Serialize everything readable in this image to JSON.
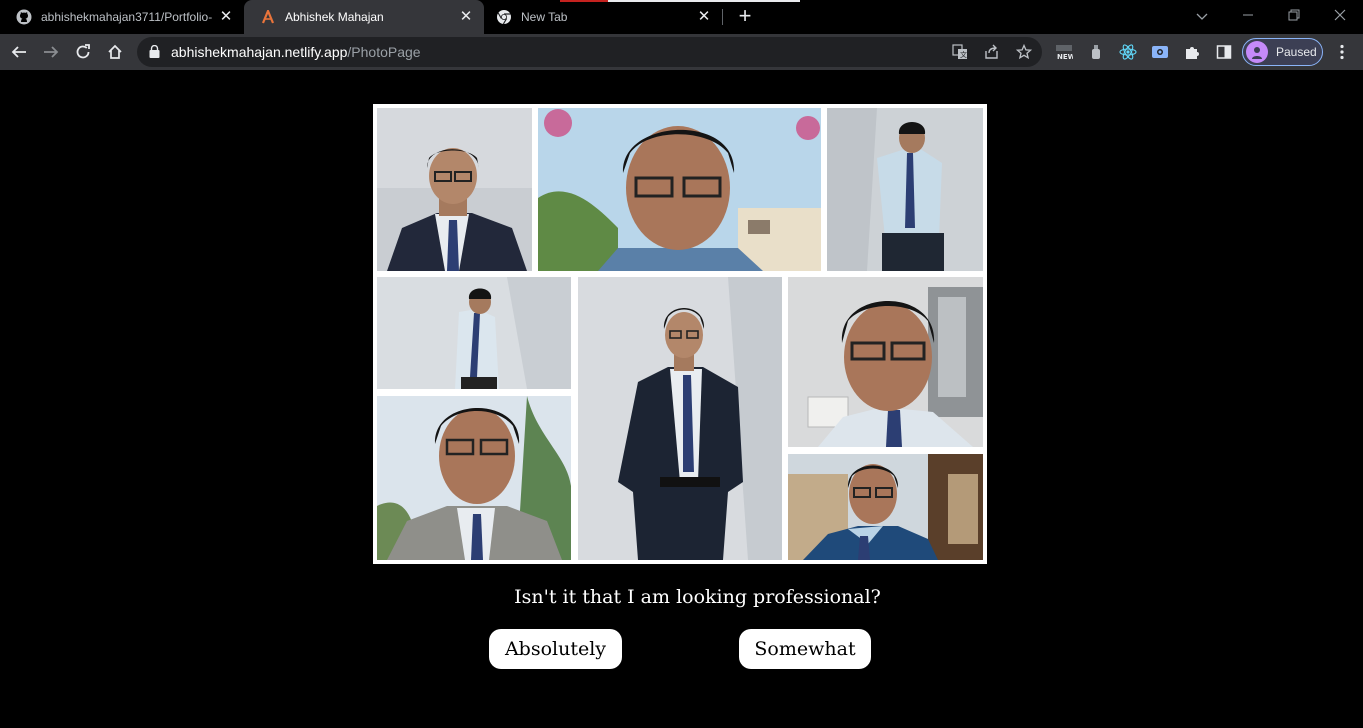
{
  "browser": {
    "tabs": [
      {
        "title": "abhishekmahajan3711/Portfolio-",
        "icon": "github-icon",
        "active": false
      },
      {
        "title": "Abhishek Mahajan",
        "icon": "angular-icon",
        "active": true
      },
      {
        "title": "New Tab",
        "icon": "chrome-icon",
        "active": false
      }
    ],
    "url": {
      "domain": "abhishekmahajan.netlify.app",
      "path": "/PhotoPage"
    },
    "profile": {
      "label": "Paused"
    },
    "colors": {
      "tab_progress": "#c5221f",
      "profile_border": "#8ab4f8",
      "angular": "#e8743b"
    }
  },
  "page": {
    "question": "Isn't it that I am looking professional?",
    "buttons": {
      "yes": "Absolutely",
      "no": "Somewhat"
    }
  }
}
